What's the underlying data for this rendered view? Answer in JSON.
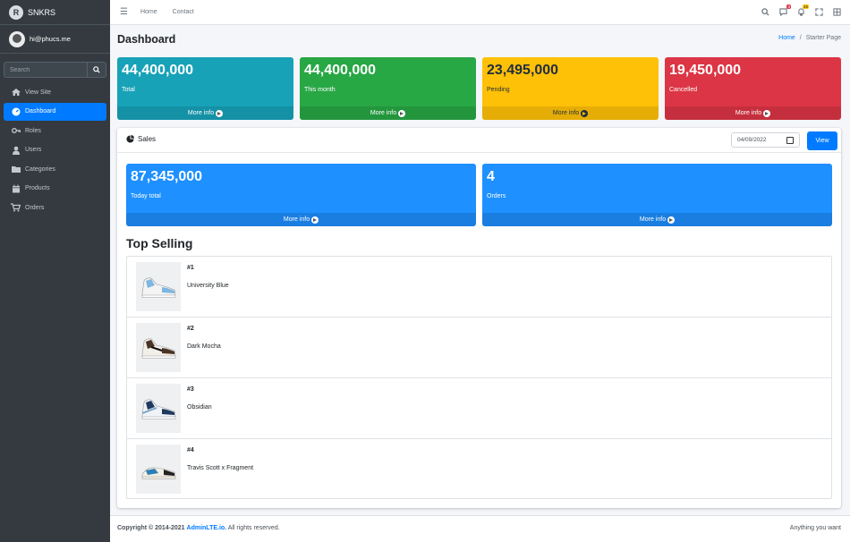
{
  "brand": {
    "name": "SNKRS",
    "logo_letter": "R"
  },
  "user": {
    "email": "hi@phucs.me"
  },
  "sidebar": {
    "search_placeholder": "Search",
    "items": [
      {
        "label": "View Site",
        "icon": "home-icon",
        "active": false
      },
      {
        "label": "Dashboard",
        "icon": "dashboard-icon",
        "active": true
      },
      {
        "label": "Roles",
        "icon": "key-icon",
        "active": false
      },
      {
        "label": "Users",
        "icon": "user-icon",
        "active": false
      },
      {
        "label": "Categories",
        "icon": "folder-icon",
        "active": false
      },
      {
        "label": "Products",
        "icon": "calendar-icon",
        "active": false
      },
      {
        "label": "Orders",
        "icon": "cart-icon",
        "active": false
      }
    ]
  },
  "topbar": {
    "links": [
      "Home",
      "Contact"
    ],
    "icons": [
      "search-icon",
      "comments-icon",
      "bell-icon",
      "expand-icon",
      "grid-icon"
    ],
    "badges": {
      "comments": "3",
      "notifications": "15"
    }
  },
  "header": {
    "title": "Dashboard",
    "breadcrumb_home": "Home",
    "breadcrumb_sep": "/",
    "breadcrumb_current": "Starter Page"
  },
  "stats": [
    {
      "value": "44,400,000",
      "label": "Total",
      "more": "More info",
      "color": "#17a2b8"
    },
    {
      "value": "44,400,000",
      "label": "This month",
      "more": "More info",
      "color": "#28a745"
    },
    {
      "value": "23,495,000",
      "label": "Pending",
      "more": "More info",
      "color": "#ffc107"
    },
    {
      "value": "19,450,000",
      "label": "Cancelled",
      "more": "More info",
      "color": "#dc3545"
    }
  ],
  "sales": {
    "title": "Sales",
    "date_value": "04/09/2022",
    "view_label": "View",
    "boxes": [
      {
        "value": "87,345,000",
        "label": "Today total",
        "more": "More info"
      },
      {
        "value": "4",
        "label": "Orders",
        "more": "More info"
      }
    ]
  },
  "top_selling": {
    "title": "Top Selling",
    "items": [
      {
        "rank": "#1",
        "name": "University Blue",
        "accent": "#7fb6e0"
      },
      {
        "rank": "#2",
        "name": "Dark Mocha",
        "accent": "#4a3426"
      },
      {
        "rank": "#3",
        "name": "Obsidian",
        "accent": "#1f3a5f"
      },
      {
        "rank": "#4",
        "name": "Travis Scott x Fragment",
        "accent": "#2a7fb8"
      }
    ]
  },
  "footer": {
    "copyright_prefix": "Copyright © 2014-2021",
    "link": "AdminLTE.io.",
    "suffix": "All rights reserved.",
    "right": "Anything you want"
  }
}
